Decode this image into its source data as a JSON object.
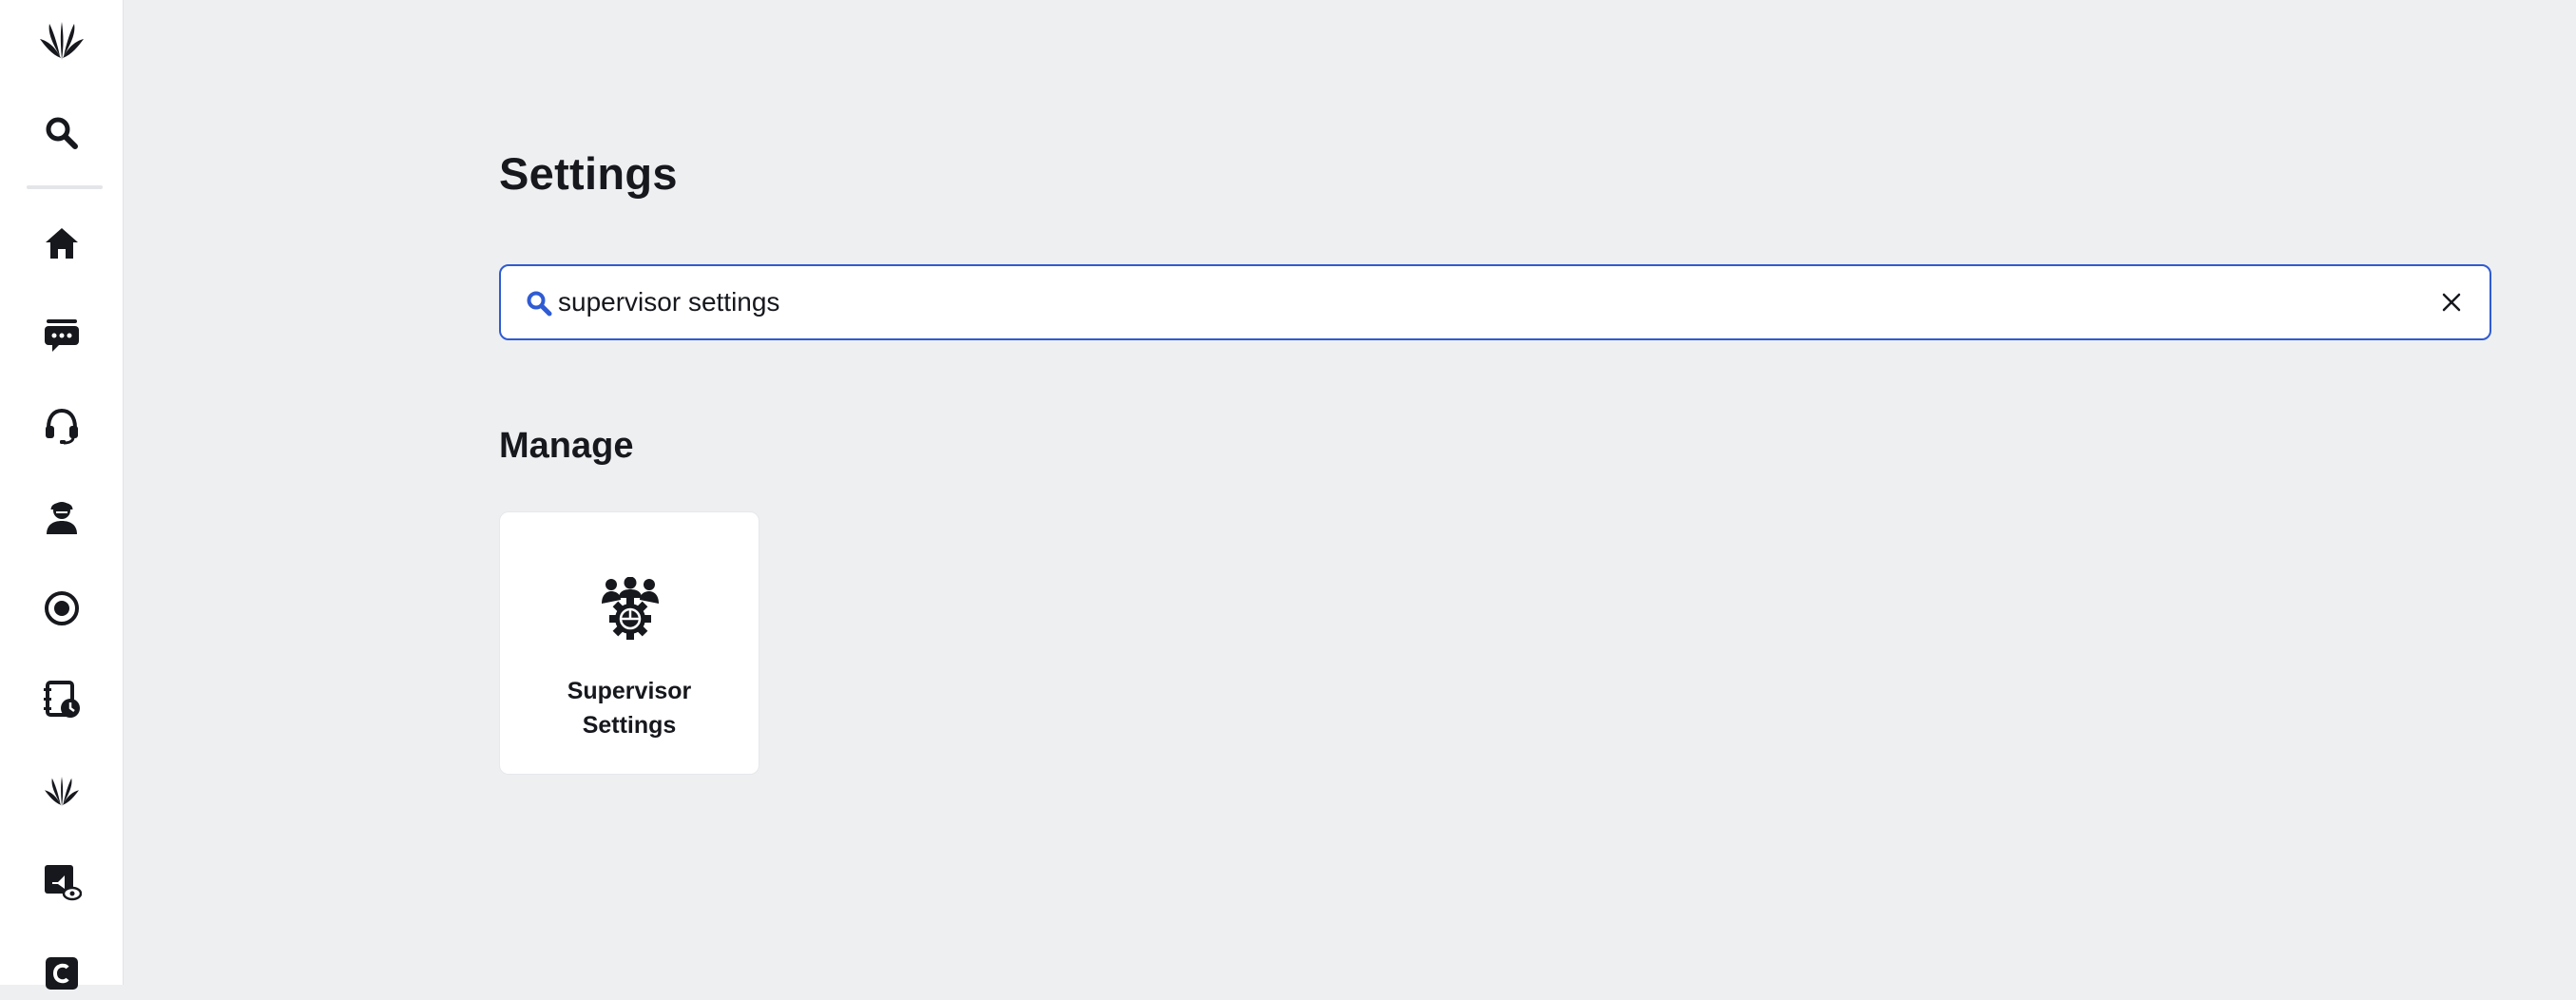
{
  "sidebar": {
    "items": [
      {
        "icon": "sprinklr-logo-icon"
      },
      {
        "icon": "search-icon"
      },
      {
        "icon": "home-icon"
      },
      {
        "icon": "conversations-icon"
      },
      {
        "icon": "headset-icon"
      },
      {
        "icon": "agent-icon"
      },
      {
        "icon": "record-icon"
      },
      {
        "icon": "contact-book-clock-icon"
      },
      {
        "icon": "sprinklr-app-icon"
      },
      {
        "icon": "broadcast-view-icon"
      },
      {
        "icon": "c-square-icon"
      }
    ]
  },
  "page": {
    "title": "Settings"
  },
  "search": {
    "value": "supervisor settings",
    "placeholder": "",
    "accent_color": "#2f5bd3"
  },
  "manage": {
    "title": "Manage",
    "cards": [
      {
        "label": "Supervisor Settings",
        "icon": "supervisor-settings-icon"
      }
    ]
  }
}
